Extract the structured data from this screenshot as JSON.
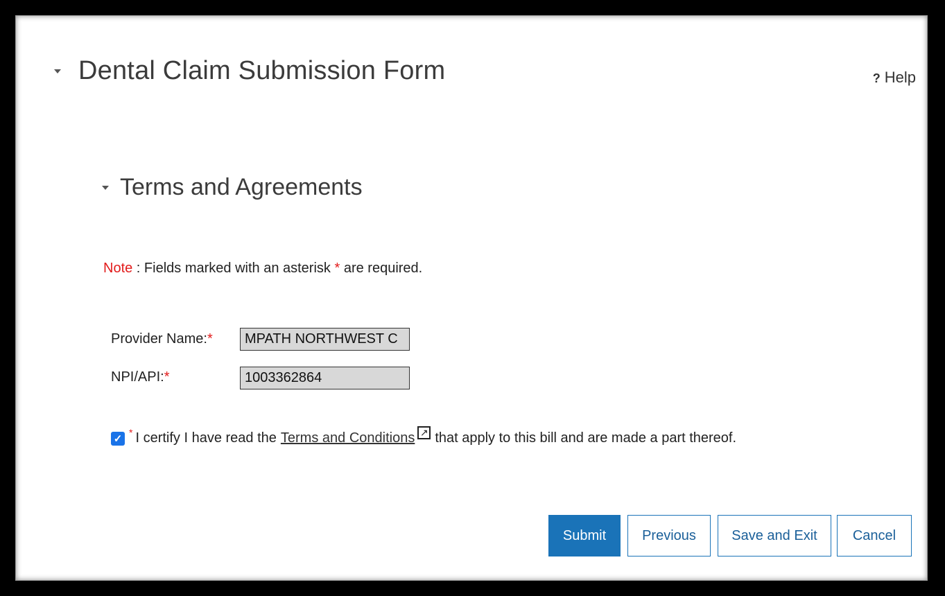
{
  "header": {
    "title": "Dental Claim Submission Form",
    "help_icon": "?",
    "help_label": "Help"
  },
  "section": {
    "title": "Terms and Agreements"
  },
  "note": {
    "prefix": "Note",
    "text_before": " : Fields marked with an asterisk ",
    "asterisk": "*",
    "text_after": " are required."
  },
  "fields": {
    "provider_name_label": "Provider Name:",
    "provider_name_value": "MPATH NORTHWEST C",
    "npi_label": "NPI/API:",
    "npi_value": "1003362864",
    "required_mark": "*"
  },
  "certify": {
    "checked": true,
    "check_glyph": "✓",
    "required_mark": "*",
    "text_before": "I certify I have read the",
    "link_label": "Terms and Conditions",
    "ext_glyph": "↗",
    "text_after": "that apply to this bill and are made a part thereof."
  },
  "buttons": {
    "submit": "Submit",
    "previous": "Previous",
    "save_exit": "Save and Exit",
    "cancel": "Cancel"
  },
  "colors": {
    "accent": "#1a73b8",
    "required": "#e21b1b",
    "checkbox": "#1a73e8"
  }
}
